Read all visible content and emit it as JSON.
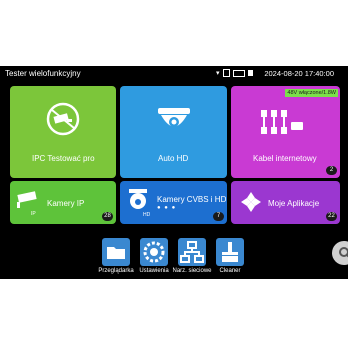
{
  "statusbar": {
    "app_title": "Tester wielofunkcyjny",
    "datetime": "2024-08-20 17:40:00"
  },
  "tiles": {
    "ipc": {
      "label": "IPC Testować pro",
      "color": "#7cc63a"
    },
    "autohd": {
      "label": "Auto HD",
      "color": "#2f9be0"
    },
    "cable": {
      "label": "Kabel internetowy",
      "badge": "2",
      "notice": "48V włączone/1.8W",
      "color": "#c93ad3"
    },
    "kamera_ip": {
      "label": "Kamery IP",
      "sub": "IP",
      "badge": "28",
      "color": "#5ec33a"
    },
    "cvbs": {
      "label": "Kamery CVBS i HD",
      "sub": "HD",
      "badge": "7",
      "color": "#1d6fd0"
    },
    "apps": {
      "label": "Moje Aplikacje",
      "badge": "22",
      "color": "#9b37d0"
    }
  },
  "dock": {
    "browser": "Przeglądarka",
    "settings": "Ustawienia",
    "network": "Narz. sieciowe",
    "cleaner": "Cleaner"
  }
}
